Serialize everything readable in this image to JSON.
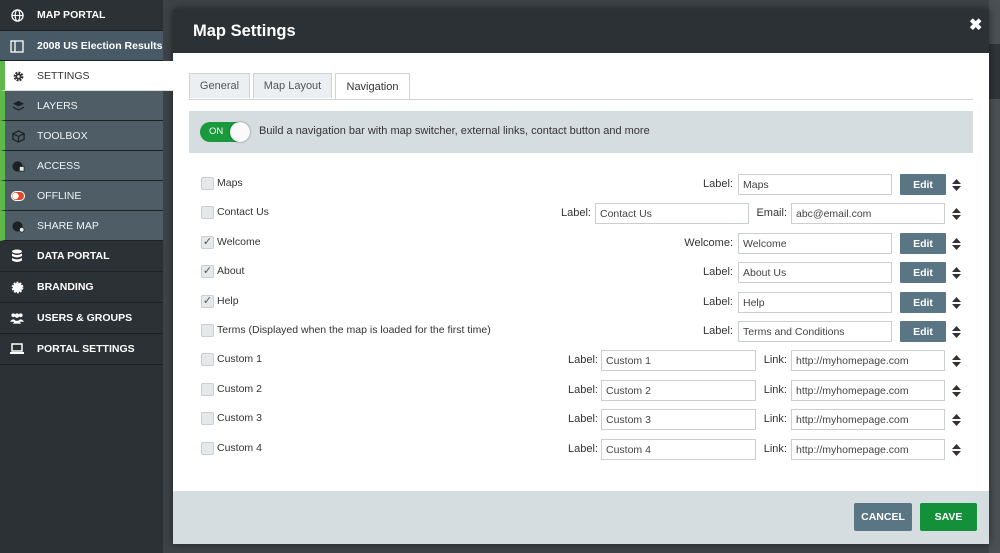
{
  "sidebar": {
    "items": [
      {
        "label": "MAP PORTAL",
        "icon": "globe-icon"
      },
      {
        "label": "2008 US Election Results...",
        "icon": "map-panel-icon"
      },
      {
        "label": "SETTINGS",
        "icon": "gear-icon"
      },
      {
        "label": "LAYERS",
        "icon": "layers-icon"
      },
      {
        "label": "TOOLBOX",
        "icon": "cube-icon"
      },
      {
        "label": "ACCESS",
        "icon": "access-icon"
      },
      {
        "label": "OFFLINE",
        "icon": "toggle-icon"
      },
      {
        "label": "SHARE MAP",
        "icon": "share-globe-icon"
      },
      {
        "label": "DATA PORTAL",
        "icon": "database-icon"
      },
      {
        "label": "BRANDING",
        "icon": "badge-icon"
      },
      {
        "label": "USERS & GROUPS",
        "icon": "users-icon"
      },
      {
        "label": "PORTAL SETTINGS",
        "icon": "laptop-icon"
      }
    ]
  },
  "modal": {
    "title": "Map Settings",
    "close_icon": "close-icon",
    "tabs": [
      {
        "label": "General"
      },
      {
        "label": "Map Layout"
      },
      {
        "label": "Navigation"
      }
    ],
    "active_tab": "Navigation",
    "toggle_label": "ON",
    "toggle_description": "Build a navigation bar with map switcher, external links, contact button and more",
    "rows": [
      {
        "label": "Maps",
        "checked": false,
        "field_label": "Label:",
        "field_value": "Maps",
        "edit_label": "Edit"
      },
      {
        "label": "Contact Us",
        "checked": false,
        "field_label": "Label:",
        "field_value": "Contact Us",
        "email_label": "Email:",
        "email_value": "abc@email.com"
      },
      {
        "label": "Welcome",
        "checked": true,
        "field_label": "Welcome:",
        "field_value": "Welcome",
        "edit_label": "Edit"
      },
      {
        "label": "About",
        "checked": true,
        "field_label": "Label:",
        "field_value": "About Us",
        "edit_label": "Edit"
      },
      {
        "label": "Help",
        "checked": true,
        "field_label": "Label:",
        "field_value": "Help",
        "edit_label": "Edit"
      },
      {
        "label": "Terms (Displayed when the map is loaded for the first time)",
        "checked": false,
        "field_label": "Label:",
        "field_value": "Terms and Conditions",
        "edit_label": "Edit"
      },
      {
        "label": "Custom 1",
        "checked": false,
        "field_label": "Label:",
        "field_value": "Custom 1",
        "link_label": "Link:",
        "link_value": "http://myhomepage.com"
      },
      {
        "label": "Custom 2",
        "checked": false,
        "field_label": "Label:",
        "field_value": "Custom 2",
        "link_label": "Link:",
        "link_value": "http://myhomepage.com"
      },
      {
        "label": "Custom 3",
        "checked": false,
        "field_label": "Label:",
        "field_value": "Custom 3",
        "link_label": "Link:",
        "link_value": "http://myhomepage.com"
      },
      {
        "label": "Custom 4",
        "checked": false,
        "field_label": "Label:",
        "field_value": "Custom 4",
        "link_label": "Link:",
        "link_value": "http://myhomepage.com"
      }
    ],
    "checkmark": "✓",
    "footer": {
      "cancel_label": "CANCEL",
      "save_label": "SAVE"
    }
  },
  "colors": {
    "sidebar_bg": "#2b3135",
    "accent_green": "#5fb84a",
    "toggle_green": "#1a9a3c",
    "edit_button": "#5a7583",
    "cancel_button": "#5a7583",
    "save_button": "#14903b"
  }
}
